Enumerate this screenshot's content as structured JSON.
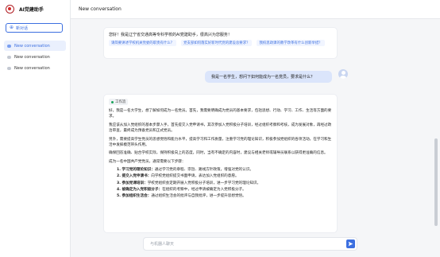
{
  "app": {
    "title": "AI党建助手"
  },
  "sidebar": {
    "new_chat_label": "新对话",
    "conversations": [
      {
        "label": "New conversation",
        "active": true
      },
      {
        "label": "New conversation",
        "active": false
      },
      {
        "label": "New conversation",
        "active": false
      }
    ]
  },
  "header": {
    "title": "New conversation"
  },
  "messages": {
    "greeting": {
      "text": "您好！我是辽宁省交通高等专科学校的AI党建助手，很高兴为您服务！",
      "suggestions": [
        "请简要讲述学校机关党委的职责有什么？",
        "党支部如何落实好新时代党的建设总要求？",
        "我校思政课的教学改革有什么创新举措？"
      ]
    },
    "user": {
      "text": "我是一名学生，想问下如何能成为一名党员，要求是什么？"
    },
    "answer": {
      "tag": "工作流",
      "paragraphs": [
        "好，我是一名大学生，想了解如何成为一名党员。首先，我需要明确成为党员的基本要求，包括思想、行动、学习、工作、生活等方面的要求。",
        "我应该从加入党组织的基本步骤入手，首先提交入党申请书，其次参加入党积极分子培训，经过组织考察和考核，成为发展对象，再经过政治审查，最终成为预备党员和正式党员。",
        "另外，需要提高学生党员的思想觉悟和能力水平，提高学习和工作质量，注重学习党的理论知识，积极参加党组织的各项活动，在学习和生活中发挥模范带头作用。",
        "确保回答准确、贴合学校实际，保持积极向上的态度，同时，当有不确定的内容时，建议与相关老师或辅导员联系以获得更准确的信息。",
        "成为一名中国共产党党员，通常需要以下步骤："
      ],
      "list": [
        {
          "title": "1. 学习党的理论知识：",
          "text": "通过学习党的章程、宗旨、路线方针政策，增强对党的认识。"
        },
        {
          "title": "2. 提交入党申请书：",
          "text": "向学校党组织提交书面申请，表达加入党组织的意愿。"
        },
        {
          "title": "3. 参加党课培训：",
          "text": "学校党组织会定期开展入党积极分子培训，进一步学习党的理论知识。"
        },
        {
          "title": "4. 被确定为入党积极分子：",
          "text": "在组织的考察中，经过申请被确定为入党积极分子。"
        },
        {
          "title": "5. 参加组织生活会：",
          "text": "通过组织生活会的批评与自我批评，进一步提升思想觉悟。"
        }
      ]
    }
  },
  "composer": {
    "placeholder": "与机器人聊天"
  },
  "colors": {
    "accent": "#3c6fe0",
    "brand": "#b01e24",
    "user_bubble": "#dbe5fb"
  }
}
